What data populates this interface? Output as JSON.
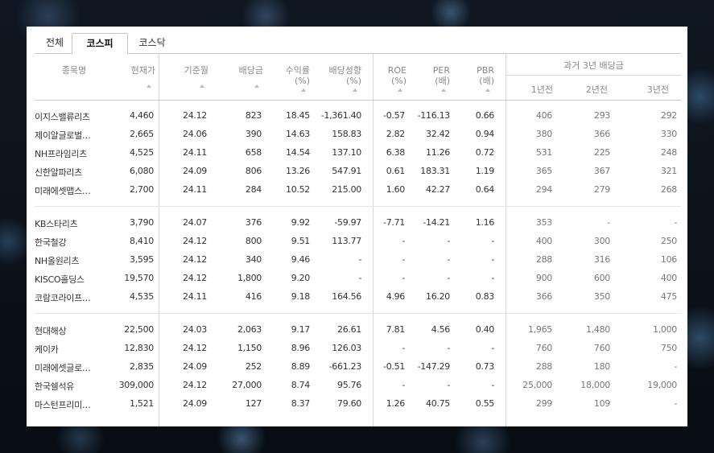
{
  "tabs": [
    {
      "label": "전체",
      "active": false
    },
    {
      "label": "코스피",
      "active": true
    },
    {
      "label": "코스닥",
      "active": false
    }
  ],
  "headers": {
    "name": "종목명",
    "price": "현재가",
    "base_month": "기준월",
    "dividend": "배당금",
    "yield_line1": "수익률",
    "yield_line2": "(%)",
    "growth_line1": "배당성향",
    "growth_line2": "(%)",
    "roe_line1": "ROE",
    "roe_line2": "(%)",
    "per_line1": "PER",
    "per_line2": "(배)",
    "pbr_line1": "PBR",
    "pbr_line2": "(배)",
    "past_title": "과거 3년 배당금",
    "y1": "1년전",
    "y2": "2년전",
    "y3": "3년전"
  },
  "rows": [
    {
      "name": "이지스밸류리츠",
      "price": "4,460",
      "base": "24.12",
      "div": "823",
      "yield": "18.45",
      "payout": "-1,361.40",
      "roe": "-0.57",
      "per": "-116.13",
      "pbr": "0.66",
      "y1": "406",
      "y2": "293",
      "y3": "292"
    },
    {
      "name": "제이알글로벌…",
      "price": "2,665",
      "base": "24.06",
      "div": "390",
      "yield": "14.63",
      "payout": "158.83",
      "roe": "2.82",
      "per": "32.42",
      "pbr": "0.94",
      "y1": "380",
      "y2": "366",
      "y3": "330"
    },
    {
      "name": "NH프라임리츠",
      "price": "4,525",
      "base": "24.11",
      "div": "658",
      "yield": "14.54",
      "payout": "137.10",
      "roe": "6.38",
      "per": "11.26",
      "pbr": "0.72",
      "y1": "531",
      "y2": "225",
      "y3": "248"
    },
    {
      "name": "신한알파리츠",
      "price": "6,080",
      "base": "24.09",
      "div": "806",
      "yield": "13.26",
      "payout": "547.91",
      "roe": "0.61",
      "per": "183.31",
      "pbr": "1.19",
      "y1": "365",
      "y2": "367",
      "y3": "321"
    },
    {
      "name": "미래에셋맵스…",
      "price": "2,700",
      "base": "24.11",
      "div": "284",
      "yield": "10.52",
      "payout": "215.00",
      "roe": "1.60",
      "per": "42.27",
      "pbr": "0.64",
      "y1": "294",
      "y2": "279",
      "y3": "268"
    },
    {
      "name": "KB스타리츠",
      "price": "3,790",
      "base": "24.07",
      "div": "376",
      "yield": "9.92",
      "payout": "-59.97",
      "roe": "-7.71",
      "per": "-14.21",
      "pbr": "1.16",
      "y1": "353",
      "y2": "-",
      "y3": "-"
    },
    {
      "name": "한국철강",
      "price": "8,410",
      "base": "24.12",
      "div": "800",
      "yield": "9.51",
      "payout": "113.77",
      "roe": "-",
      "per": "-",
      "pbr": "-",
      "y1": "400",
      "y2": "300",
      "y3": "250"
    },
    {
      "name": "NH올원리츠",
      "price": "3,595",
      "base": "24.12",
      "div": "340",
      "yield": "9.46",
      "payout": "-",
      "roe": "-",
      "per": "-",
      "pbr": "-",
      "y1": "288",
      "y2": "316",
      "y3": "106"
    },
    {
      "name": "KISCO홀딩스",
      "price": "19,570",
      "base": "24.12",
      "div": "1,800",
      "yield": "9.20",
      "payout": "-",
      "roe": "-",
      "per": "-",
      "pbr": "-",
      "y1": "900",
      "y2": "600",
      "y3": "400"
    },
    {
      "name": "코람코라이프…",
      "price": "4,535",
      "base": "24.11",
      "div": "416",
      "yield": "9.18",
      "payout": "164.56",
      "roe": "4.96",
      "per": "16.20",
      "pbr": "0.83",
      "y1": "366",
      "y2": "350",
      "y3": "475"
    },
    {
      "name": "현대해상",
      "price": "22,500",
      "base": "24.03",
      "div": "2,063",
      "yield": "9.17",
      "payout": "26.61",
      "roe": "7.81",
      "per": "4.56",
      "pbr": "0.40",
      "y1": "1,965",
      "y2": "1,480",
      "y3": "1,000"
    },
    {
      "name": "케이카",
      "price": "12,830",
      "base": "24.12",
      "div": "1,150",
      "yield": "8.96",
      "payout": "126.03",
      "roe": "-",
      "per": "-",
      "pbr": "-",
      "y1": "760",
      "y2": "760",
      "y3": "750"
    },
    {
      "name": "미래에셋글로…",
      "price": "2,835",
      "base": "24.09",
      "div": "252",
      "yield": "8.89",
      "payout": "-661.23",
      "roe": "-0.51",
      "per": "-147.29",
      "pbr": "0.73",
      "y1": "288",
      "y2": "180",
      "y3": "-"
    },
    {
      "name": "한국쉘석유",
      "price": "309,000",
      "base": "24.12",
      "div": "27,000",
      "yield": "8.74",
      "payout": "95.76",
      "roe": "-",
      "per": "-",
      "pbr": "-",
      "y1": "25,000",
      "y2": "18,000",
      "y3": "19,000"
    },
    {
      "name": "마스턴프리미…",
      "price": "1,521",
      "base": "24.09",
      "div": "127",
      "yield": "8.37",
      "payout": "79.60",
      "roe": "1.26",
      "per": "40.75",
      "pbr": "0.55",
      "y1": "299",
      "y2": "109",
      "y3": "-"
    }
  ]
}
